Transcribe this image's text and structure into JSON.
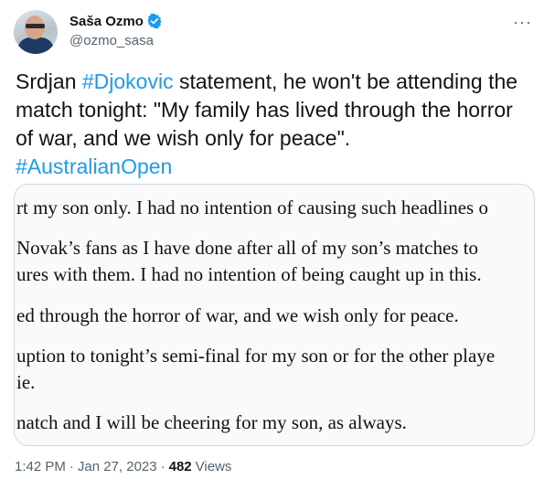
{
  "author": {
    "display_name": "Saša Ozmo",
    "handle": "@ozmo_sasa",
    "verified_color": "#1d9bf0"
  },
  "more_icon": "···",
  "tweet": {
    "text_1": "Srdjan ",
    "hashtag_1": "#Djokovic",
    "text_2": " statement, he won't be attending the match tonight: \"My family has lived through the horror of war, and we wish only for peace\".",
    "hashtag_2": "#AustralianOpen"
  },
  "statement_lines": [
    "rt my son only. I had no intention of causing such headlines o",
    "Novak’s fans as I have done after all of my son’s matches to",
    "ures with them. I had no intention of being caught up in this.",
    "ed through the horror of war, and we wish only for peace.",
    "uption to tonight’s semi-final for my son or for the other playe",
    "ie.",
    "natch and I will be cheering for my son, as always."
  ],
  "meta": {
    "time": "1:42 PM",
    "date": "Jan 27, 2023",
    "separator": "·",
    "views_count": "482",
    "views_label": "Views"
  }
}
